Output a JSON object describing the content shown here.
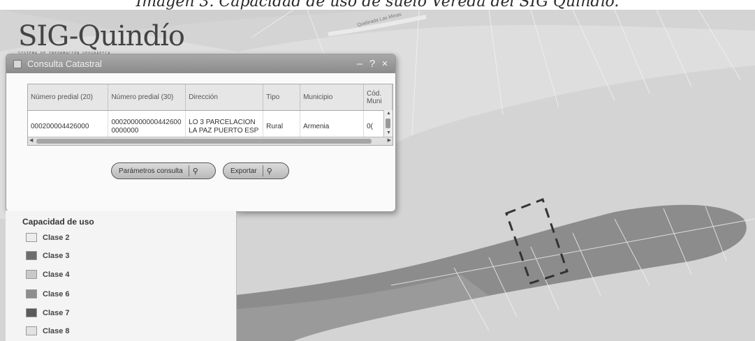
{
  "caption": "Imagen 3. Capacidad de uso de suelo Vereda del SIG Quindío.",
  "logo": {
    "text": "SIG-Quindío",
    "subtitle": "SISTEMA DE INFORMACIÓN GEOGRÁFICA"
  },
  "map": {
    "road_label": "Quebrada Las Minas"
  },
  "dialog": {
    "title": "Consulta Catastral",
    "controls": {
      "minimize": "–",
      "help": "?",
      "close": "×"
    },
    "columns": [
      "Número predial (20)",
      "Número predial (30)",
      "Dirección",
      "Tipo",
      "Municipio",
      "Cód. Muni"
    ],
    "row": {
      "predial20": "000200004426000",
      "predial30": "0002000000004426000000000",
      "direccion": "LO 3 PARCELACION LA PAZ PUERTO ESP",
      "tipo": "Rural",
      "municipio": "Armenia",
      "cod": "0("
    },
    "buttons": {
      "params": "Parámetros consulta",
      "export": "Exportar"
    }
  },
  "legend": {
    "title": "Capacidad de uso",
    "items": [
      {
        "label": "Clase 2",
        "color": "#ececec"
      },
      {
        "label": "Clase 3",
        "color": "#6d6d6d"
      },
      {
        "label": "Clase 4",
        "color": "#c9c9c9"
      },
      {
        "label": "Clase 6",
        "color": "#8e8e8e"
      },
      {
        "label": "Clase 7",
        "color": "#5a5a5a"
      },
      {
        "label": "Clase 8",
        "color": "#e2e2e2"
      }
    ]
  }
}
